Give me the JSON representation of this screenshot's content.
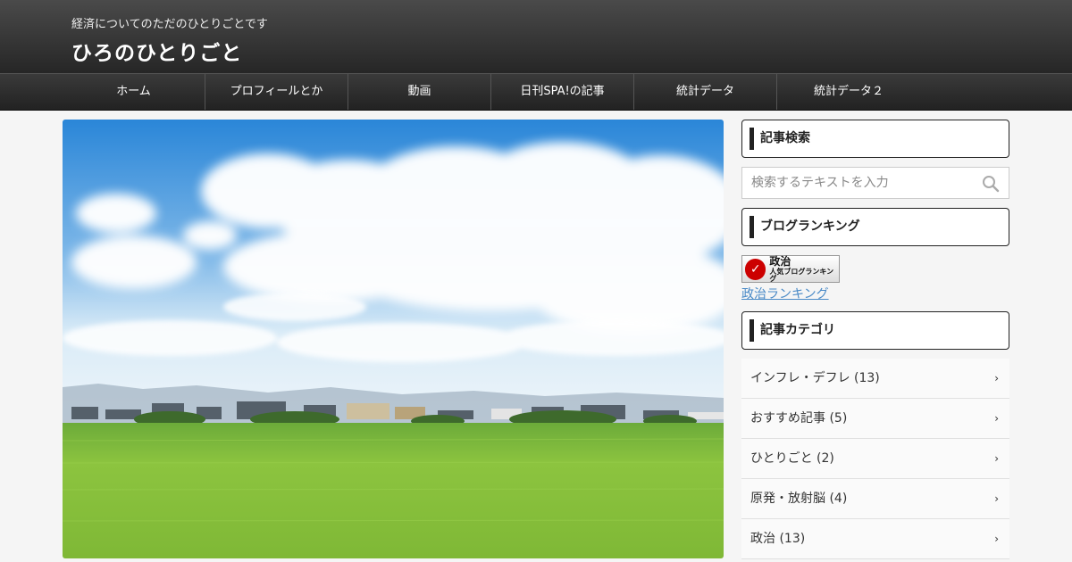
{
  "header": {
    "tagline": "経済についてのただのひとりごとです",
    "site_title": "ひろのひとりごと"
  },
  "nav": {
    "items": [
      {
        "label": "ホーム"
      },
      {
        "label": "プロフィールとか"
      },
      {
        "label": "動画"
      },
      {
        "label": "日刊SPA!の記事"
      },
      {
        "label": "統計データ"
      },
      {
        "label": "統計データ２"
      }
    ]
  },
  "sidebar": {
    "search": {
      "title": "記事検索",
      "placeholder": "検索するテキストを入力",
      "icon": "search-icon"
    },
    "ranking": {
      "title": "ブログランキング",
      "banner_main": "政治",
      "banner_sub": "人気ブログランキング",
      "link_text": "政治ランキング"
    },
    "categories": {
      "title": "記事カテゴリ",
      "items": [
        {
          "label": "インフレ・デフレ (13)"
        },
        {
          "label": "おすすめ記事 (5)"
        },
        {
          "label": "ひとりごと (2)"
        },
        {
          "label": "原発・放射脳 (4)"
        },
        {
          "label": "政治 (13)"
        }
      ]
    }
  },
  "colors": {
    "header_bg": "#2e2e2e",
    "link": "#4a8ac7",
    "accent_bar": "#222222"
  }
}
